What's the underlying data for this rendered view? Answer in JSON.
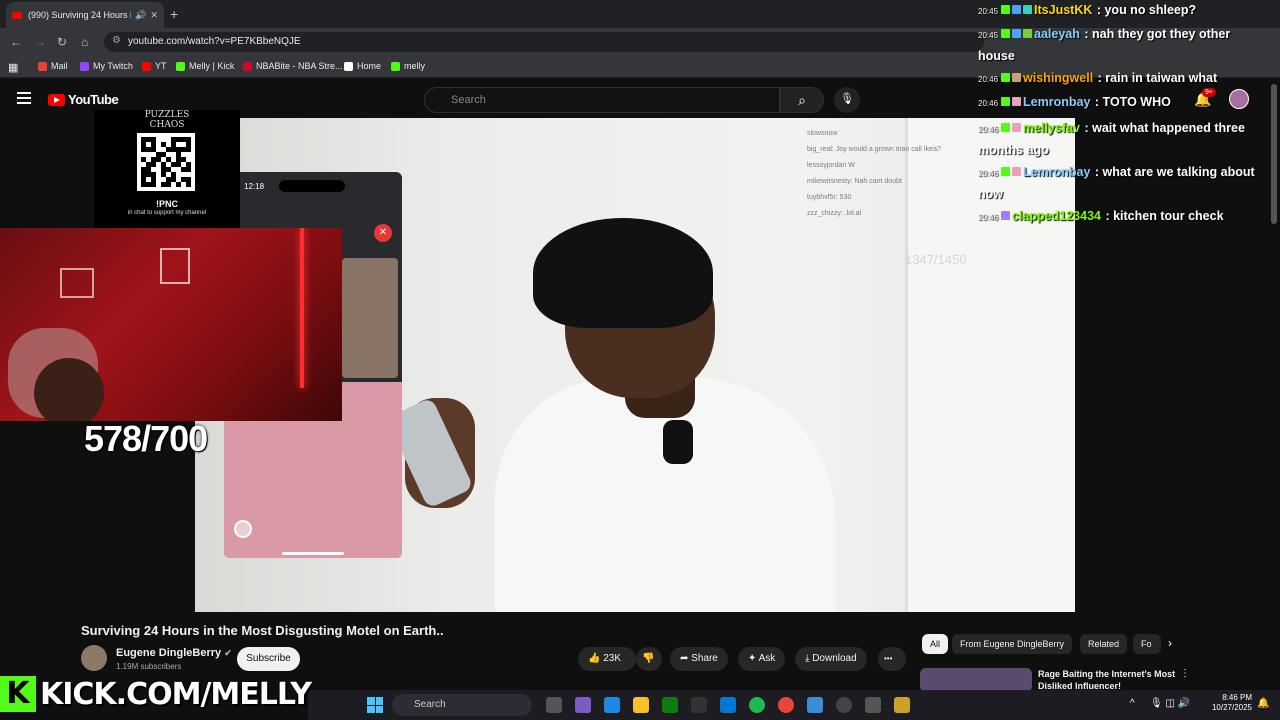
{
  "browser": {
    "tab_title": "(990) Surviving 24 Hours in the M",
    "tab_speaker": "🔊",
    "tab_close": "✕",
    "new_tab": "+",
    "url": "youtube.com/watch?v=PE7KBbeNQJE",
    "bookmarks": [
      {
        "label": "Mail",
        "color": "#ea4335"
      },
      {
        "label": "My Twitch",
        "color": "#9146ff"
      },
      {
        "label": "YT",
        "color": "#ff0000"
      },
      {
        "label": "Melly | Kick",
        "color": "#53fc18"
      },
      {
        "label": "NBABite - NBA Stre...",
        "color": "#c9082a"
      },
      {
        "label": "Home",
        "color": "#ffffff"
      },
      {
        "label": "melly",
        "color": "#53fc18"
      }
    ]
  },
  "youtube": {
    "logo": "YouTube",
    "search_placeholder": "Search",
    "notification_count": "9+"
  },
  "stream_overlay": {
    "puzzles_text": "PUZZLES CHAOS",
    "pnc_label": "!PNC",
    "pnc_sub": "in chat to support my channel",
    "counter": "578/700",
    "video_counter": "1347/1450",
    "facetime_time": "12:18",
    "kick_k": "K",
    "kick_text": "KICK.COM/MELLY"
  },
  "video_chat_overlay": [
    "slowsnow",
    "big_real: Joy would a grown man call Ikea?",
    "lessoyjordan W",
    "mikewitsnesty: Nah cant doubt",
    "tuybhvf5r: 530",
    "zzz_chizzy: .lol.al"
  ],
  "chat": [
    {
      "ts": "20:45",
      "user": "ItsJustKK",
      "text": "you no shleep?",
      "color": "#ffd700",
      "badges": [
        "#53fc18",
        "#4aa3ff",
        "#3ad0c0"
      ]
    },
    {
      "ts": "20:45",
      "user": "aaleyah",
      "text": "nah they got they other house",
      "color": "#87cefa",
      "badges": [
        "#53fc18",
        "#4aa3ff",
        "#74d13c"
      ]
    },
    {
      "ts": "20:46",
      "user": "wishingwell",
      "text": "rain in taiwan what",
      "color": "#ffa500",
      "badges": [
        "#53fc18",
        "#c8a07a"
      ]
    },
    {
      "ts": "20:46",
      "user": "Lemronbay",
      "text": "TOTO WHO",
      "color": "#87cefa",
      "badges": [
        "#53fc18",
        "#e8a2b8"
      ]
    },
    {
      "ts": "20:46",
      "user": "mellysfav",
      "text": "wait what happened three months ago",
      "color": "#7cfc00",
      "badges": [
        "#53fc18",
        "#e8a2b8"
      ]
    },
    {
      "ts": "20:46",
      "user": "Lemronbay",
      "text": "what are we talking about now",
      "color": "#87cefa",
      "badges": [
        "#53fc18",
        "#e8a2b8"
      ]
    },
    {
      "ts": "20:46",
      "user": "clapped123434",
      "text": "kitchen tour check",
      "color": "#7cfc00",
      "badges": [
        "#a57bff"
      ]
    }
  ],
  "video_info": {
    "title": "Surviving 24 Hours in the Most Disgusting Motel on Earth..",
    "channel": "Eugene DingleBerry",
    "verified": "✔",
    "subscribers": "1.19M subscribers",
    "subscribe_label": "Subscribe",
    "likes": "23K",
    "share_label": "Share",
    "ask_label": "Ask",
    "download_label": "Download",
    "more": "•••"
  },
  "chips": [
    "All",
    "From Eugene DingleBerry",
    "Related",
    "Fo"
  ],
  "recommended": {
    "title": "Rage Baiting the Internet's Most Disliked Influencer!"
  },
  "taskbar": {
    "search_label": "Search",
    "time": "8:46 PM",
    "date": "10/27/2025"
  }
}
